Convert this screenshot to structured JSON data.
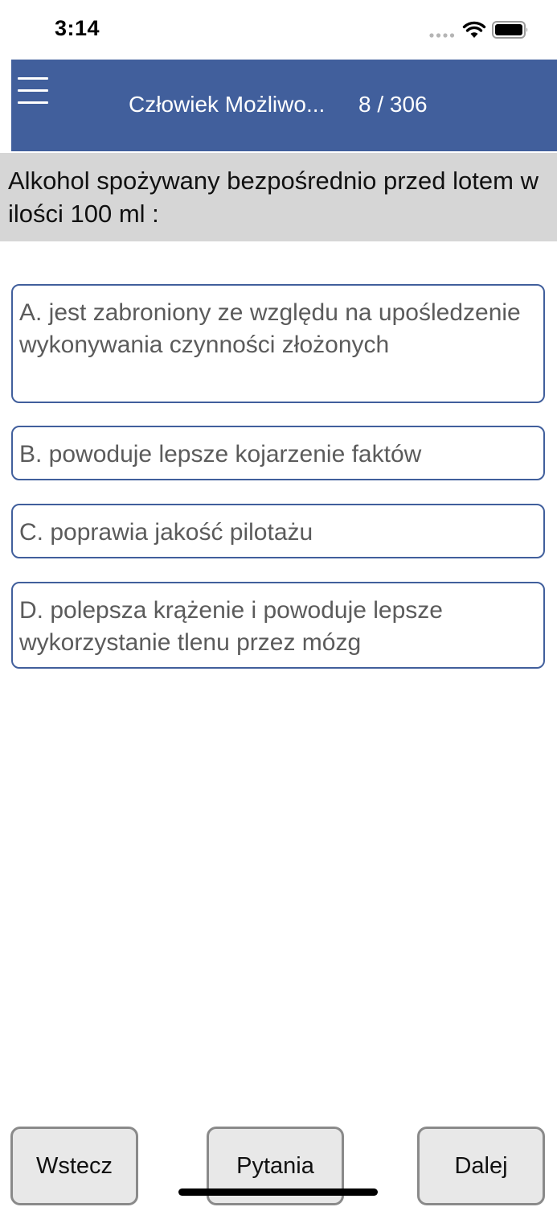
{
  "status_bar": {
    "time": "3:14"
  },
  "nav": {
    "title": "Człowiek Możliwo...",
    "counter": "8 / 306"
  },
  "question": {
    "text": "Alkohol spożywany bezpośrednio przed lotem w ilości 100 ml :"
  },
  "answers": [
    {
      "label": "A. jest zabroniony ze względu na upośledzenie wykonywania czynności złożonych"
    },
    {
      "label": "B. powoduje lepsze kojarzenie faktów"
    },
    {
      "label": "C. poprawia jakość pilotażu"
    },
    {
      "label": "D. polepsza krążenie i powoduje lepsze wykorzystanie tlenu przez mózg"
    }
  ],
  "buttons": {
    "back": "Wstecz",
    "questions": "Pytania",
    "next": "Dalej"
  },
  "colors": {
    "nav_bg": "#415f9c",
    "question_bg": "#d6d6d6",
    "answer_border": "#415f9c",
    "button_bg": "#e8e8e8"
  }
}
